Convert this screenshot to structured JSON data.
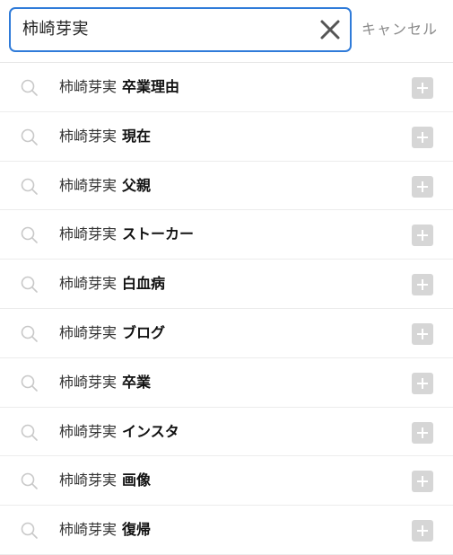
{
  "search": {
    "query": "柿崎芽実",
    "cancel_label": "キャンセル"
  },
  "suggestions": [
    {
      "query": "柿崎芽実",
      "suffix": "卒業理由"
    },
    {
      "query": "柿崎芽実",
      "suffix": "現在"
    },
    {
      "query": "柿崎芽実",
      "suffix": "父親"
    },
    {
      "query": "柿崎芽実",
      "suffix": "ストーカー"
    },
    {
      "query": "柿崎芽実",
      "suffix": "白血病"
    },
    {
      "query": "柿崎芽実",
      "suffix": "ブログ"
    },
    {
      "query": "柿崎芽実",
      "suffix": "卒業"
    },
    {
      "query": "柿崎芽実",
      "suffix": "インスタ"
    },
    {
      "query": "柿崎芽実",
      "suffix": "画像"
    },
    {
      "query": "柿崎芽実",
      "suffix": "復帰"
    }
  ],
  "colors": {
    "focus_border": "#2f7bd9",
    "plus_button": "#d6d6d6",
    "icon_gray": "#c8c8c8"
  },
  "icons": {
    "row_leading": "search-icon",
    "row_trailing": "plus-icon",
    "clear": "close-icon"
  }
}
